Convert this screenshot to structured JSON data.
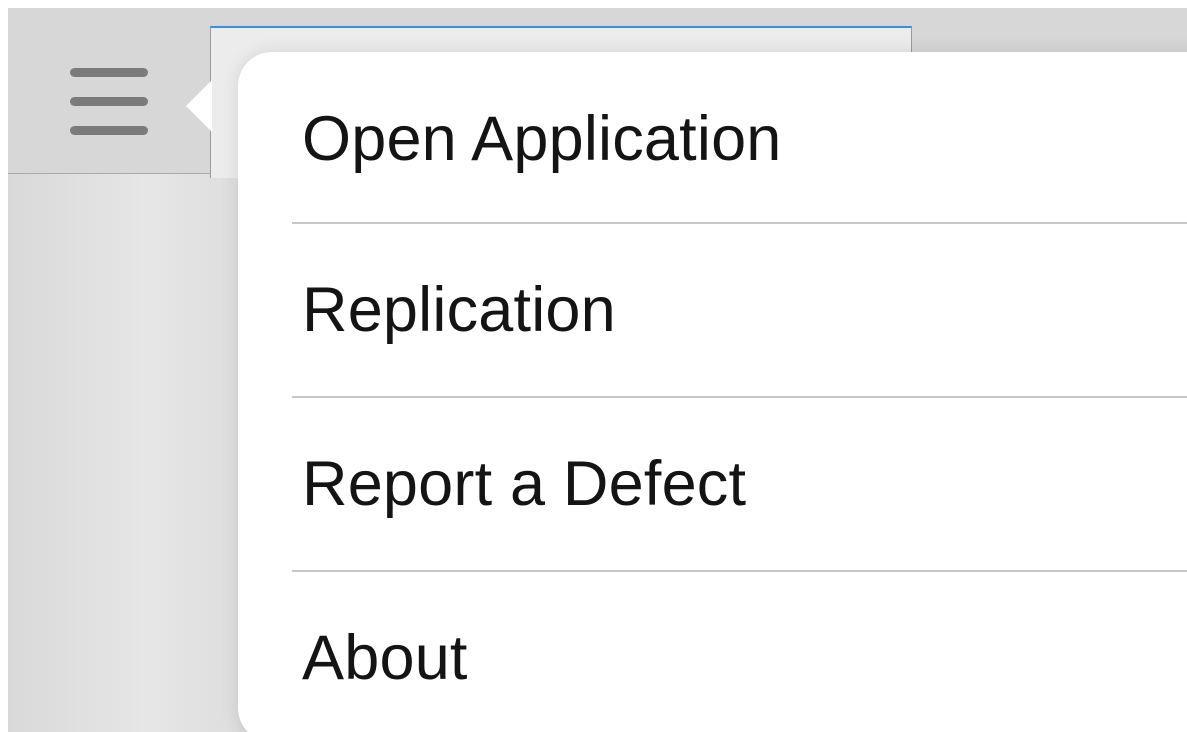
{
  "toolbar": {
    "menu_icon": "hamburger-menu-icon"
  },
  "popover_menu": {
    "items": [
      {
        "label": "Open Application"
      },
      {
        "label": "Replication"
      },
      {
        "label": "Report a Defect"
      },
      {
        "label": "About"
      }
    ]
  },
  "colors": {
    "background": "#dcdcdc",
    "popover": "#ffffff",
    "text": "#141414",
    "separator": "#c8c8c8",
    "focus_accent": "#3b8ee0",
    "icon": "#7b7b7b"
  }
}
